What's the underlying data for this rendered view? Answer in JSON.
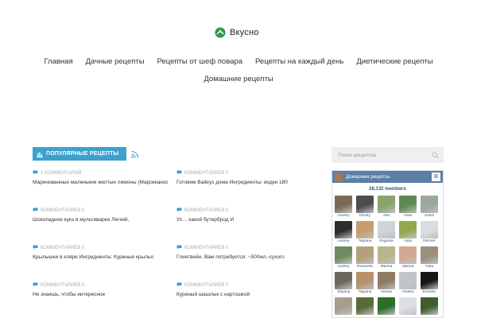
{
  "site": {
    "name": "Вкусно"
  },
  "nav": {
    "row1": [
      "Главная",
      "Дачные рецепты",
      "Рецепты от шеф повара",
      "Рецепты на каждый день",
      "Диетические рецепты"
    ],
    "row2": [
      "Домашние рецепты"
    ]
  },
  "popular": {
    "heading": "ПОПУЛЯРНЫЕ РЕЦЕПТЫ",
    "posts": [
      {
        "meta": "1 КОММЕНТАРИЙ",
        "title": "Маринованные маленькие желтые лимоны (Марокканская"
      },
      {
        "meta": "КОММЕНТАРИЕВ 0",
        "title": "Готовим Baileys дома Ингредиенты: водки 180"
      },
      {
        "meta": "КОММЕНТАРИЕВ 0",
        "title": "Шоколадное кукэ в мультиварке Легкий,"
      },
      {
        "meta": "КОММЕНТАРИЕВ 0",
        "title": "Ух… какой бутерброд И"
      },
      {
        "meta": "КОММЕНТАРИЕВ 0",
        "title": "Крылышки в кляре Ингредиенты: Куриные крылья"
      },
      {
        "meta": "КОММЕНТАРИЕВ 0",
        "title": "Глинтвейн. Вам потребуется: ~500мл.-сухого"
      },
      {
        "meta": "КОММЕНТАРИЕВ 0",
        "title": "Не знаешь, чтобы интересное"
      },
      {
        "meta": "КОММЕНТАРИЕВ 0",
        "title": "Куриный шашлык с картошкой"
      }
    ]
  },
  "search": {
    "placeholder": "Поиск рецептов"
  },
  "vk": {
    "group": "Домашние рецепты",
    "logo": "B",
    "members": "28,132 members",
    "users": [
      {
        "name": "Andrey",
        "color": "#7b6a55"
      },
      {
        "name": "Dmitry",
        "color": "#4d4d4d"
      },
      {
        "name": "Alla",
        "color": "#8aa36b"
      },
      {
        "name": "Yulia",
        "color": "#5e8a52"
      },
      {
        "name": "Anton",
        "color": "#9aa79a"
      },
      {
        "name": "Andrey",
        "color": "#2e2e2e"
      },
      {
        "name": "Tatyana",
        "color": "#c89c6e"
      },
      {
        "name": "Evgenia",
        "color": "#cfd4da"
      },
      {
        "name": "Yulia",
        "color": "#93a84f"
      },
      {
        "name": "Denser",
        "color": "#d9dde2"
      },
      {
        "name": "Andrey",
        "color": "#6f8a5e"
      },
      {
        "name": "Elizaveta",
        "color": "#b4a07a"
      },
      {
        "name": "Marina",
        "color": "#b9b58c"
      },
      {
        "name": "Valeria",
        "color": "#d2a894"
      },
      {
        "name": "Yulia",
        "color": "#9b8f7c"
      },
      {
        "name": "Tatyana",
        "color": "#6c665b"
      },
      {
        "name": "Tatyana",
        "color": "#b8906b"
      },
      {
        "name": "Alexey",
        "color": "#8c7a64"
      },
      {
        "name": "Andrey",
        "color": "#c1c5ca"
      },
      {
        "name": "Ernesto",
        "color": "#161616"
      },
      {
        "name": "",
        "color": "#a89e8f"
      },
      {
        "name": "",
        "color": "#5a6b3a"
      },
      {
        "name": "",
        "color": "#2a6e2a"
      },
      {
        "name": "",
        "color": "#dcdfe3"
      },
      {
        "name": "",
        "color": "#3f5e2c"
      }
    ]
  },
  "colors": {
    "accent": "#3ca1cc",
    "logo": "#2e9a44",
    "vk": "#5b7fa6"
  }
}
